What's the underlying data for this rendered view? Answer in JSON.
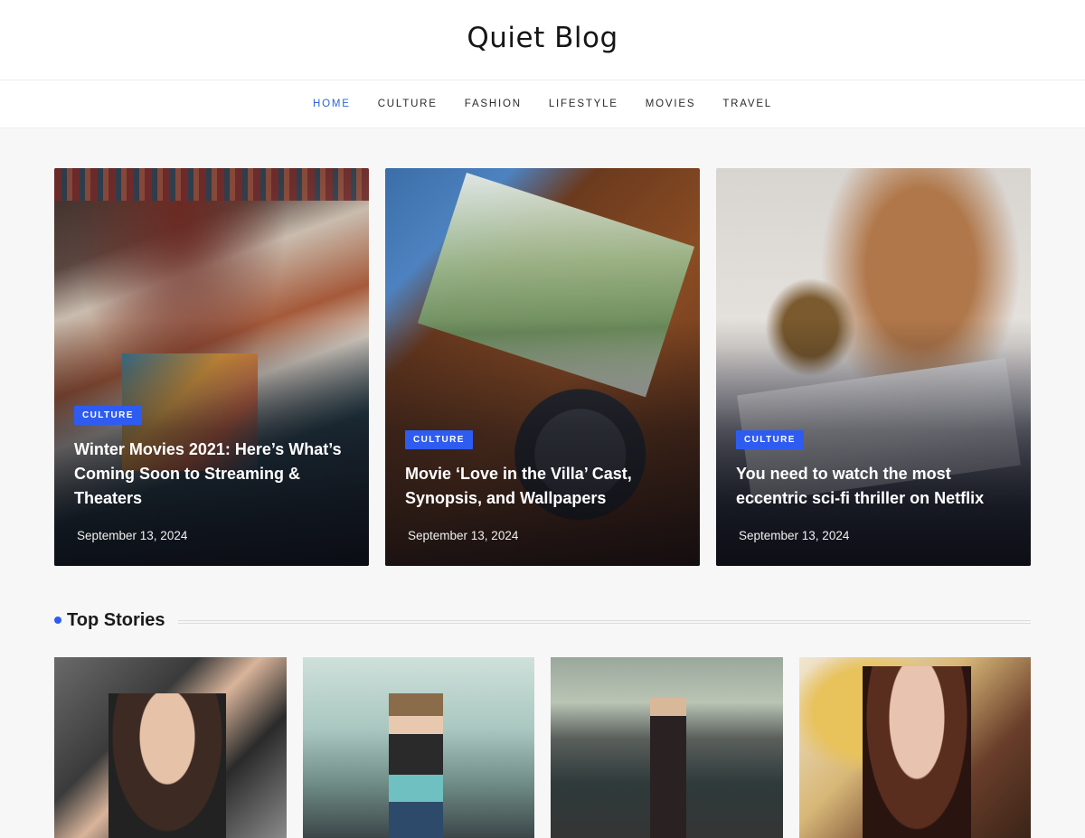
{
  "site": {
    "title": "Quiet Blog"
  },
  "nav": {
    "items": [
      {
        "label": "HOME",
        "active": true
      },
      {
        "label": "CULTURE",
        "active": false
      },
      {
        "label": "FASHION",
        "active": false
      },
      {
        "label": "LIFESTYLE",
        "active": false
      },
      {
        "label": "MOVIES",
        "active": false
      },
      {
        "label": "TRAVEL",
        "active": false
      }
    ],
    "active_color": "#2f63d8"
  },
  "featured": [
    {
      "category": "CULTURE",
      "title": "Winter Movies 2021: Here’s What’s Coming Soon to Streaming & Theaters",
      "date": "September 13, 2024"
    },
    {
      "category": "CULTURE",
      "title": "Movie ‘Love in the Villa’ Cast, Synopsis, and Wallpapers",
      "date": "September 13, 2024"
    },
    {
      "category": "CULTURE",
      "title": "You need to watch the most eccentric sci-fi thriller on Netflix",
      "date": "September 13, 2024"
    }
  ],
  "top_stories": {
    "title": "Top Stories",
    "accent": "#2f5cf0"
  },
  "colors": {
    "badge": "#2f5cf0"
  }
}
